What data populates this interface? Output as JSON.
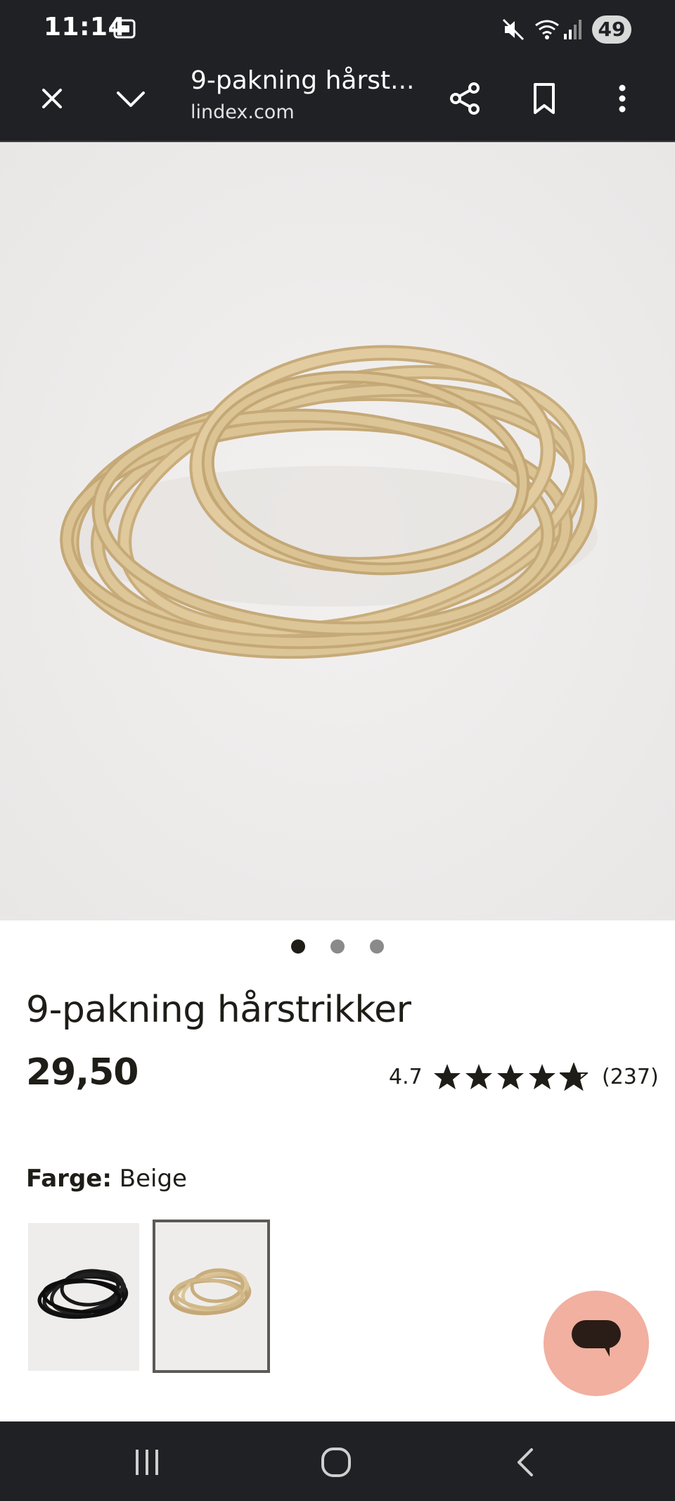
{
  "status_bar": {
    "time": "11:14",
    "battery": "49",
    "icons": [
      "screenshot-icon",
      "mute-icon",
      "wifi-icon",
      "signal-icon"
    ]
  },
  "toolbar": {
    "title": "9-pakning hårst...",
    "url": "lindex.com",
    "icons": [
      "close-icon",
      "chevron-down-icon",
      "share-icon",
      "bookmark-icon",
      "more-vert-icon"
    ]
  },
  "carousel": {
    "total": 3,
    "active": 1
  },
  "product": {
    "title": "9-pakning hårstrikker",
    "price": "29,50",
    "rating": "4.7",
    "rating_stars": 4.7,
    "review_count": "(237)",
    "color_label": "Farge:",
    "color_value": "Beige",
    "swatches": [
      {
        "name": "black",
        "selected": false
      },
      {
        "name": "beige",
        "selected": true
      }
    ]
  },
  "colors": {
    "bar_bg": "#202125",
    "text": "#1e1d18",
    "chat_bg": "#f1b0a0",
    "image_bg": "#efedec",
    "hair_tie": "#d1b88a"
  },
  "chat": {
    "icon": "chat-bubble-icon"
  },
  "nav_bar": {
    "icons": [
      "recents-icon",
      "home-icon",
      "back-icon"
    ]
  }
}
